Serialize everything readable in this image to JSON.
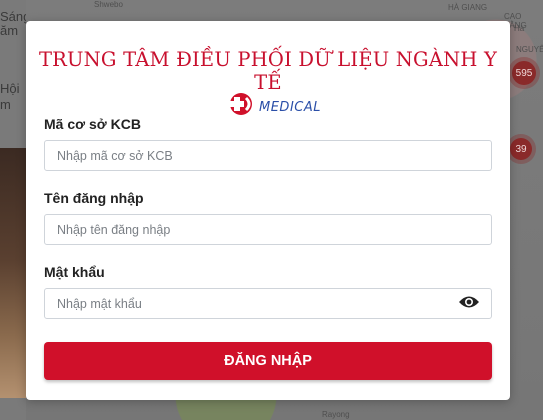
{
  "background": {
    "left_text_top": [
      "Sáng",
      "ăm"
    ],
    "left_text_mid": [
      "Hội",
      "m"
    ],
    "map_labels": [
      "Shwebo",
      "HÀ GIANG",
      "CAO BẰNG",
      "NGUYÊN",
      "Rayong",
      "Hà"
    ],
    "clusters": [
      "595",
      "39"
    ]
  },
  "modal": {
    "title": "TRUNG TÂM ĐIỀU PHỐI DỮ LIỆU NGÀNH Y TẾ",
    "logo_text": "MEDICAL",
    "fields": {
      "kcb": {
        "label": "Mã cơ sở KCB",
        "placeholder": "Nhập mã cơ sở KCB",
        "value": ""
      },
      "username": {
        "label": "Tên đăng nhập",
        "placeholder": "Nhập tên đăng nhập",
        "value": ""
      },
      "password": {
        "label": "Mật khẩu",
        "placeholder": "Nhập mật khẩu",
        "value": ""
      }
    },
    "login_label": "ĐĂNG NHẬP"
  },
  "colors": {
    "accent": "#d0102a",
    "title": "#c8102e",
    "logo_blue": "#2b4fa8"
  },
  "icons": {
    "logo": "medical-cross-logo-icon",
    "password_toggle": "eye-icon"
  }
}
